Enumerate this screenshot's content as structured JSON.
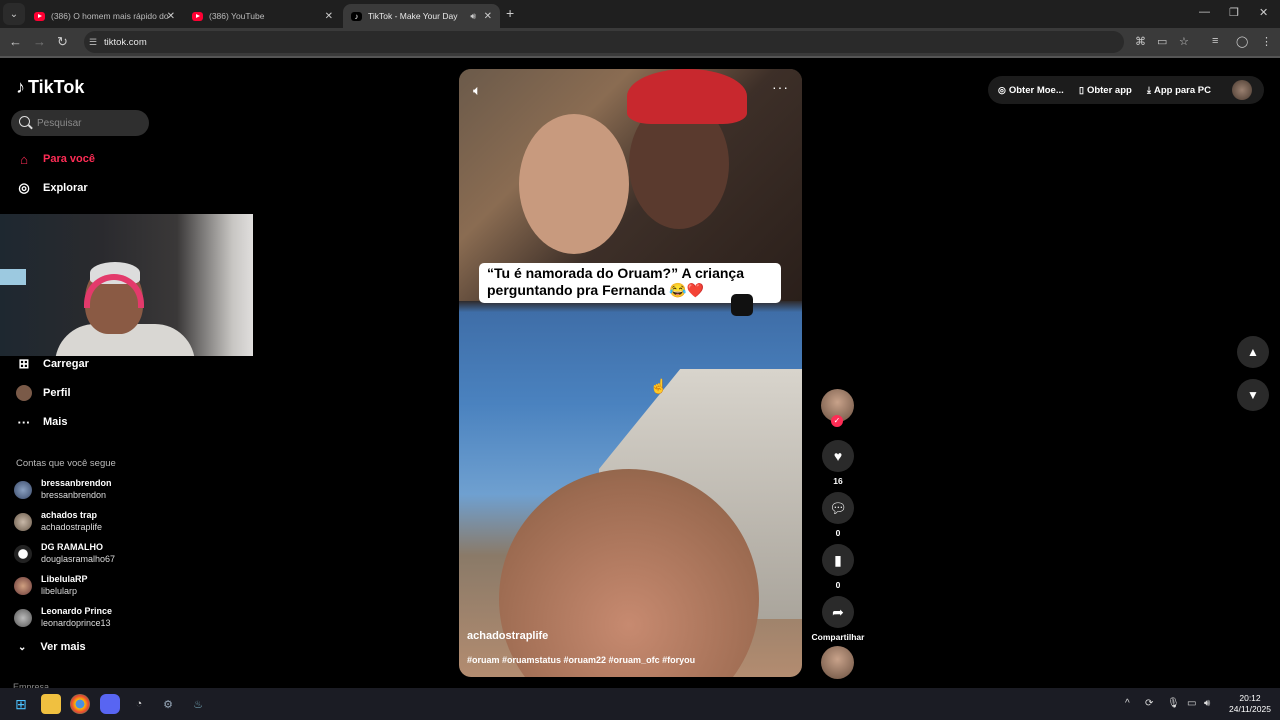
{
  "browser": {
    "tabs": [
      {
        "title": "(386) O homem mais rápido do",
        "favicon": "youtube-icon"
      },
      {
        "title": "(386) YouTube",
        "favicon": "youtube-icon"
      },
      {
        "title": "TikTok - Make Your Day",
        "favicon": "tiktok-icon"
      }
    ],
    "url": "tiktok.com"
  },
  "tiktok": {
    "logo": "TikTok",
    "search_placeholder": "Pesquisar",
    "nav": [
      {
        "label": "Para você",
        "icon": "home-icon"
      },
      {
        "label": "Explorar",
        "icon": "compass-icon"
      },
      {
        "label": "Carregar",
        "icon": "upload-icon"
      },
      {
        "label": "Perfil",
        "icon": "avatar"
      },
      {
        "label": "Mais",
        "icon": "more-icon"
      }
    ],
    "following_title": "Contas que você segue",
    "following": [
      {
        "name": "bressanbrendon",
        "handle": "bressanbrendon"
      },
      {
        "name": "achados trap",
        "handle": "achadostraplife"
      },
      {
        "name": "DG RAMALHO",
        "handle": "douglasramalho67"
      },
      {
        "name": "LibelulaRP",
        "handle": "libelularp"
      },
      {
        "name": "Leonardo Prince",
        "handle": "leonardoprince13"
      }
    ],
    "see_more": "Ver mais",
    "footer_partial": "Empresa",
    "video": {
      "caption": "“Tu é namorada do Oruam?” A criança perguntando pra Fernanda 😂❤️",
      "author": "achadostraplife",
      "hashtags": "#oruam #oruamstatus #oruam22 #oruam_ofc #foryou"
    },
    "actions": {
      "likes": "16",
      "comments": "0",
      "saves": "0",
      "share_label": "Compartilhar"
    },
    "topbar": {
      "coins": "Obter Moe...",
      "app": "Obter app",
      "pc": "App para PC"
    }
  },
  "taskbar": {
    "time": "20:12",
    "date": "24/11/2025"
  }
}
